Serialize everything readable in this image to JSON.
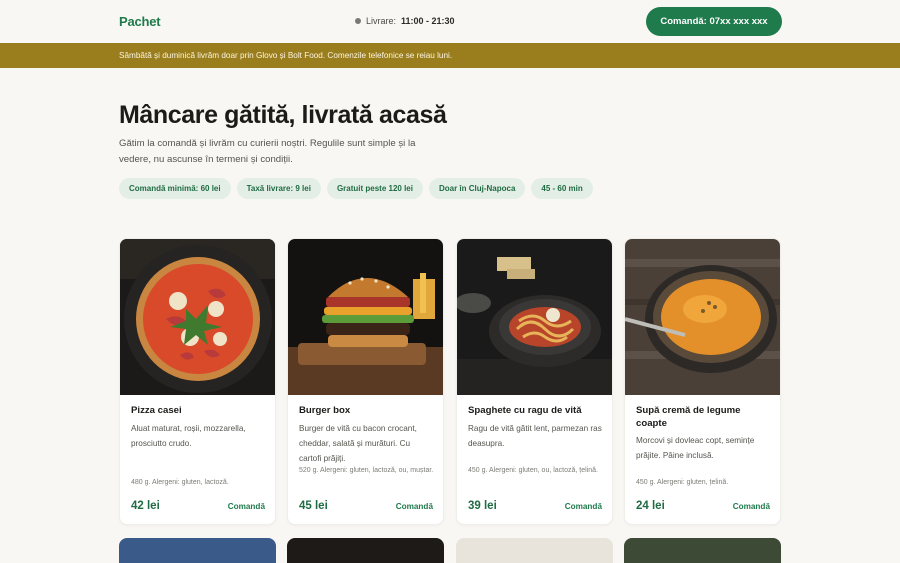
{
  "header": {
    "logo": "Pachet",
    "hours_label": "Livrare:",
    "hours_value": "11:00 - 21:30",
    "order_button": "Comandă: 07xx xxx xxx"
  },
  "banner": {
    "text": "Sâmbătă și duminică livrăm doar prin Glovo și Bolt Food. Comenzile telefonice se reiau luni."
  },
  "hero": {
    "title": "Mâncare gătită, livrată acasă",
    "subtitle": "Gătim la comandă și livrăm cu curierii noștri. Regulile sunt simple și la vedere, nu ascunse în termeni și condiții.",
    "chips": [
      "Comandă minimă: 60 lei",
      "Taxă livrare: 9 lei",
      "Gratuit peste 120 lei",
      "Doar în Cluj-Napoca",
      "45 - 60 min"
    ]
  },
  "products": [
    {
      "name": "Pizza casei",
      "description": "Aluat maturat, roșii, mozzarella, prosciutto crudo.",
      "meta": "480 g. Alergeni: gluten, lactoză.",
      "price": "42 lei",
      "action": "Comandă"
    },
    {
      "name": "Burger box",
      "description": "Burger de vită cu bacon crocant, cheddar, salată și murături. Cu cartofi prăjiți.",
      "meta": "520 g. Alergeni: gluten, lactoză, ou, muștar.",
      "price": "45 lei",
      "action": "Comandă"
    },
    {
      "name": "Spaghete cu ragu de vită",
      "description": "Ragu de vită gătit lent, parmezan ras deasupra.",
      "meta": "450 g. Alergeni: gluten, ou, lactoză, țelină.",
      "price": "39 lei",
      "action": "Comandă"
    },
    {
      "name": "Supă cremă de legume coapte",
      "description": "Morcovi și dovleac copt, semințe prăjite. Pâine inclusă.",
      "meta": "450 g. Alergeni: gluten, țelină.",
      "price": "24 lei",
      "action": "Comandă"
    }
  ],
  "colors": {
    "brand": "#1f7a4c",
    "banner": "#9a7e1e",
    "chip_bg": "#e3efe6",
    "background": "#f8f7f3"
  }
}
